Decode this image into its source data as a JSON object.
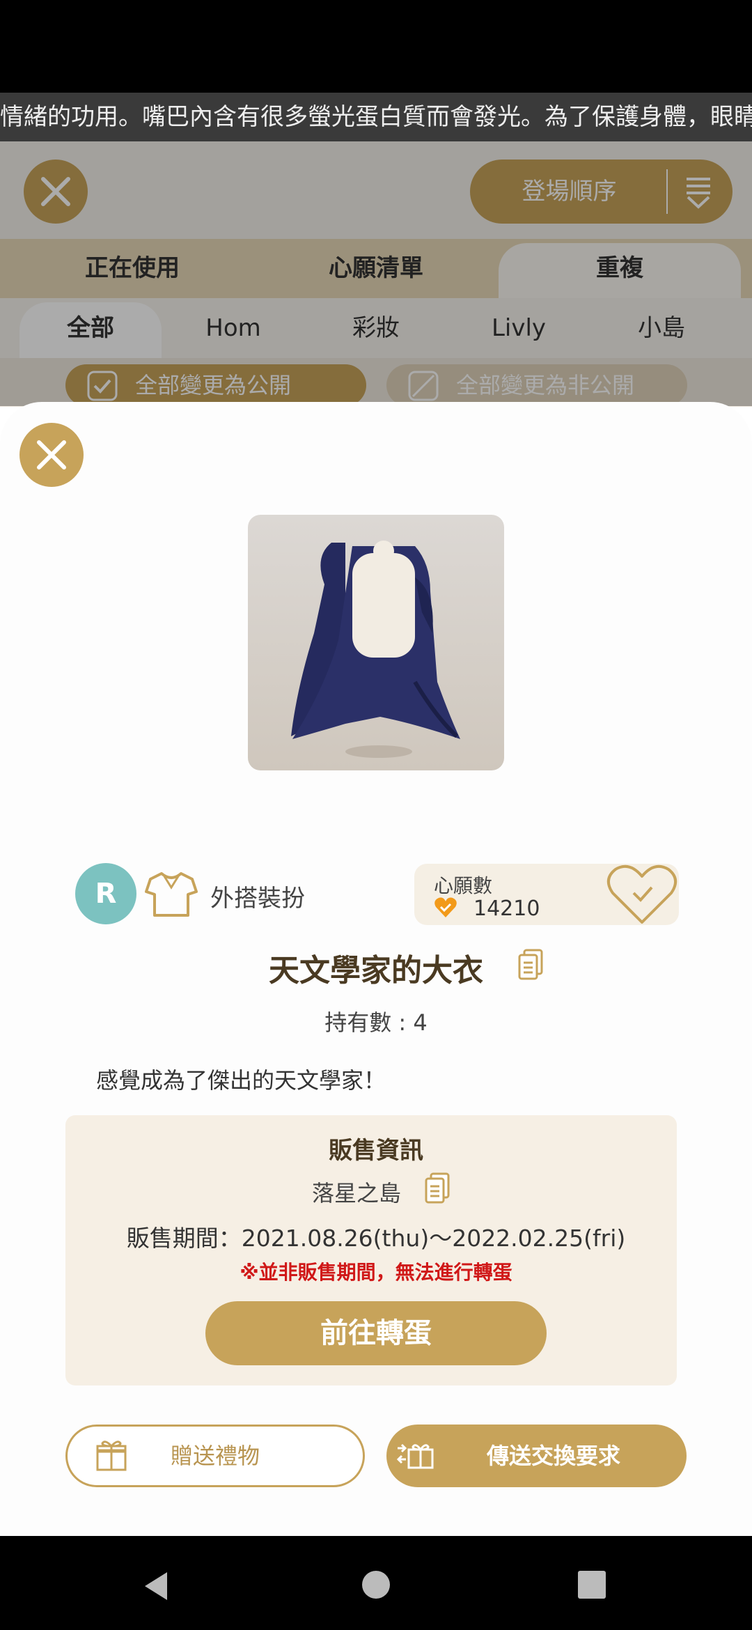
{
  "ticker": {
    "text": "情緒的功用。嘴巴內含有很多螢光蛋白質而會發光。為了保護身體，眼睛"
  },
  "background": {
    "sort_label": "登場順序",
    "tabs_primary": [
      "正在使用",
      "心願清單",
      "重複"
    ],
    "tabs_secondary": [
      "全部",
      "Hom",
      "彩妝",
      "Livly",
      "小島"
    ],
    "make_public": "全部變更為公開",
    "make_private": "全部變更為非公開"
  },
  "item": {
    "rarity": "R",
    "category": "外搭裝扮",
    "wish_label": "心願數",
    "wish_count": "14210",
    "name": "天文學家的大衣",
    "owned": "持有數 : 4",
    "description": "感覺成為了傑出的天文學家！"
  },
  "sale": {
    "title": "販售資訊",
    "place": "落星之島",
    "period": "販售期間：2021.08.26(thu)〜2022.02.25(fri)",
    "note": "※並非販售期間，無法進行轉蛋",
    "gacha_button": "前往轉蛋"
  },
  "actions": {
    "gift": "贈送禮物",
    "trade": "傳送交換要求"
  },
  "colors": {
    "accent": "#c7a35a",
    "rarity_badge": "#7cc2c0",
    "warning": "#d01818"
  },
  "icons": [
    "close-icon",
    "sort-icon",
    "check-icon",
    "shirt-icon",
    "heart-icon",
    "copy-icon",
    "gift-icon",
    "trade-icon",
    "back-icon",
    "home-icon",
    "recents-icon"
  ]
}
